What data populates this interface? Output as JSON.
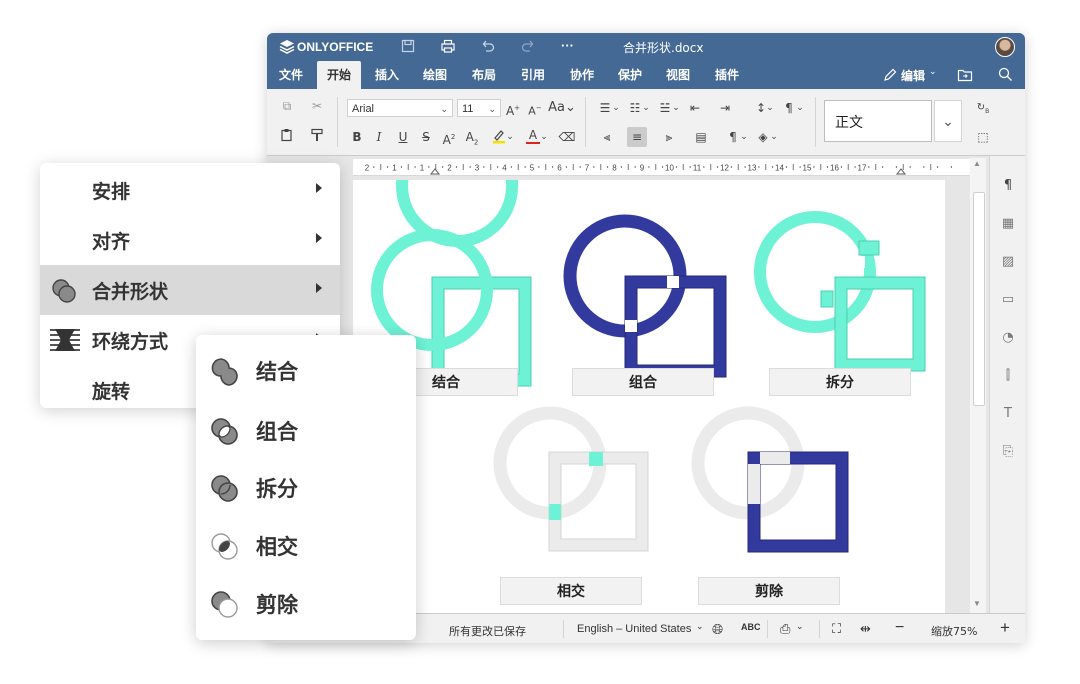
{
  "window": {
    "app_name": "ONLYOFFICE",
    "doc_title": "合并形状.docx",
    "more_label": "···"
  },
  "tabs": [
    {
      "label": "文件",
      "active": false
    },
    {
      "label": "开始",
      "active": true
    },
    {
      "label": "插入",
      "active": false
    },
    {
      "label": "绘图",
      "active": false
    },
    {
      "label": "布局",
      "active": false
    },
    {
      "label": "引用",
      "active": false
    },
    {
      "label": "协作",
      "active": false
    },
    {
      "label": "保护",
      "active": false
    },
    {
      "label": "视图",
      "active": false
    },
    {
      "label": "插件",
      "active": false
    }
  ],
  "edit_mode": "编辑",
  "toolbar": {
    "font_name": "Arial",
    "font_size": "11",
    "style_name": "正文"
  },
  "ruler_numbers": [
    "2",
    "1",
    "1",
    "2",
    "3",
    "4",
    "5",
    "6",
    "7",
    "8",
    "9",
    "10",
    "11",
    "12",
    "13",
    "14",
    "15",
    "16",
    "17"
  ],
  "shapes": {
    "labels": [
      "结合",
      "组合",
      "拆分",
      "相交",
      "剪除"
    ],
    "colors": {
      "teal": "#6ef2d6",
      "navy": "#333a9e",
      "grey": "#ebebeb",
      "grey_stroke": "#d4d4d4"
    }
  },
  "statusbar": {
    "saved": "所有更改已保存",
    "language": "English – United States",
    "zoom": "缩放75%"
  },
  "context_menu": {
    "items": [
      {
        "label": "安排",
        "submenu": true
      },
      {
        "label": "对齐",
        "submenu": true
      },
      {
        "label": "合并形状",
        "submenu": true,
        "highlighted": true
      },
      {
        "label": "环绕方式",
        "submenu": true
      },
      {
        "label": "旋转",
        "submenu": false
      }
    ]
  },
  "merge_menu": {
    "items": [
      {
        "label": "结合"
      },
      {
        "label": "组合"
      },
      {
        "label": "拆分"
      },
      {
        "label": "相交"
      },
      {
        "label": "剪除"
      }
    ]
  }
}
